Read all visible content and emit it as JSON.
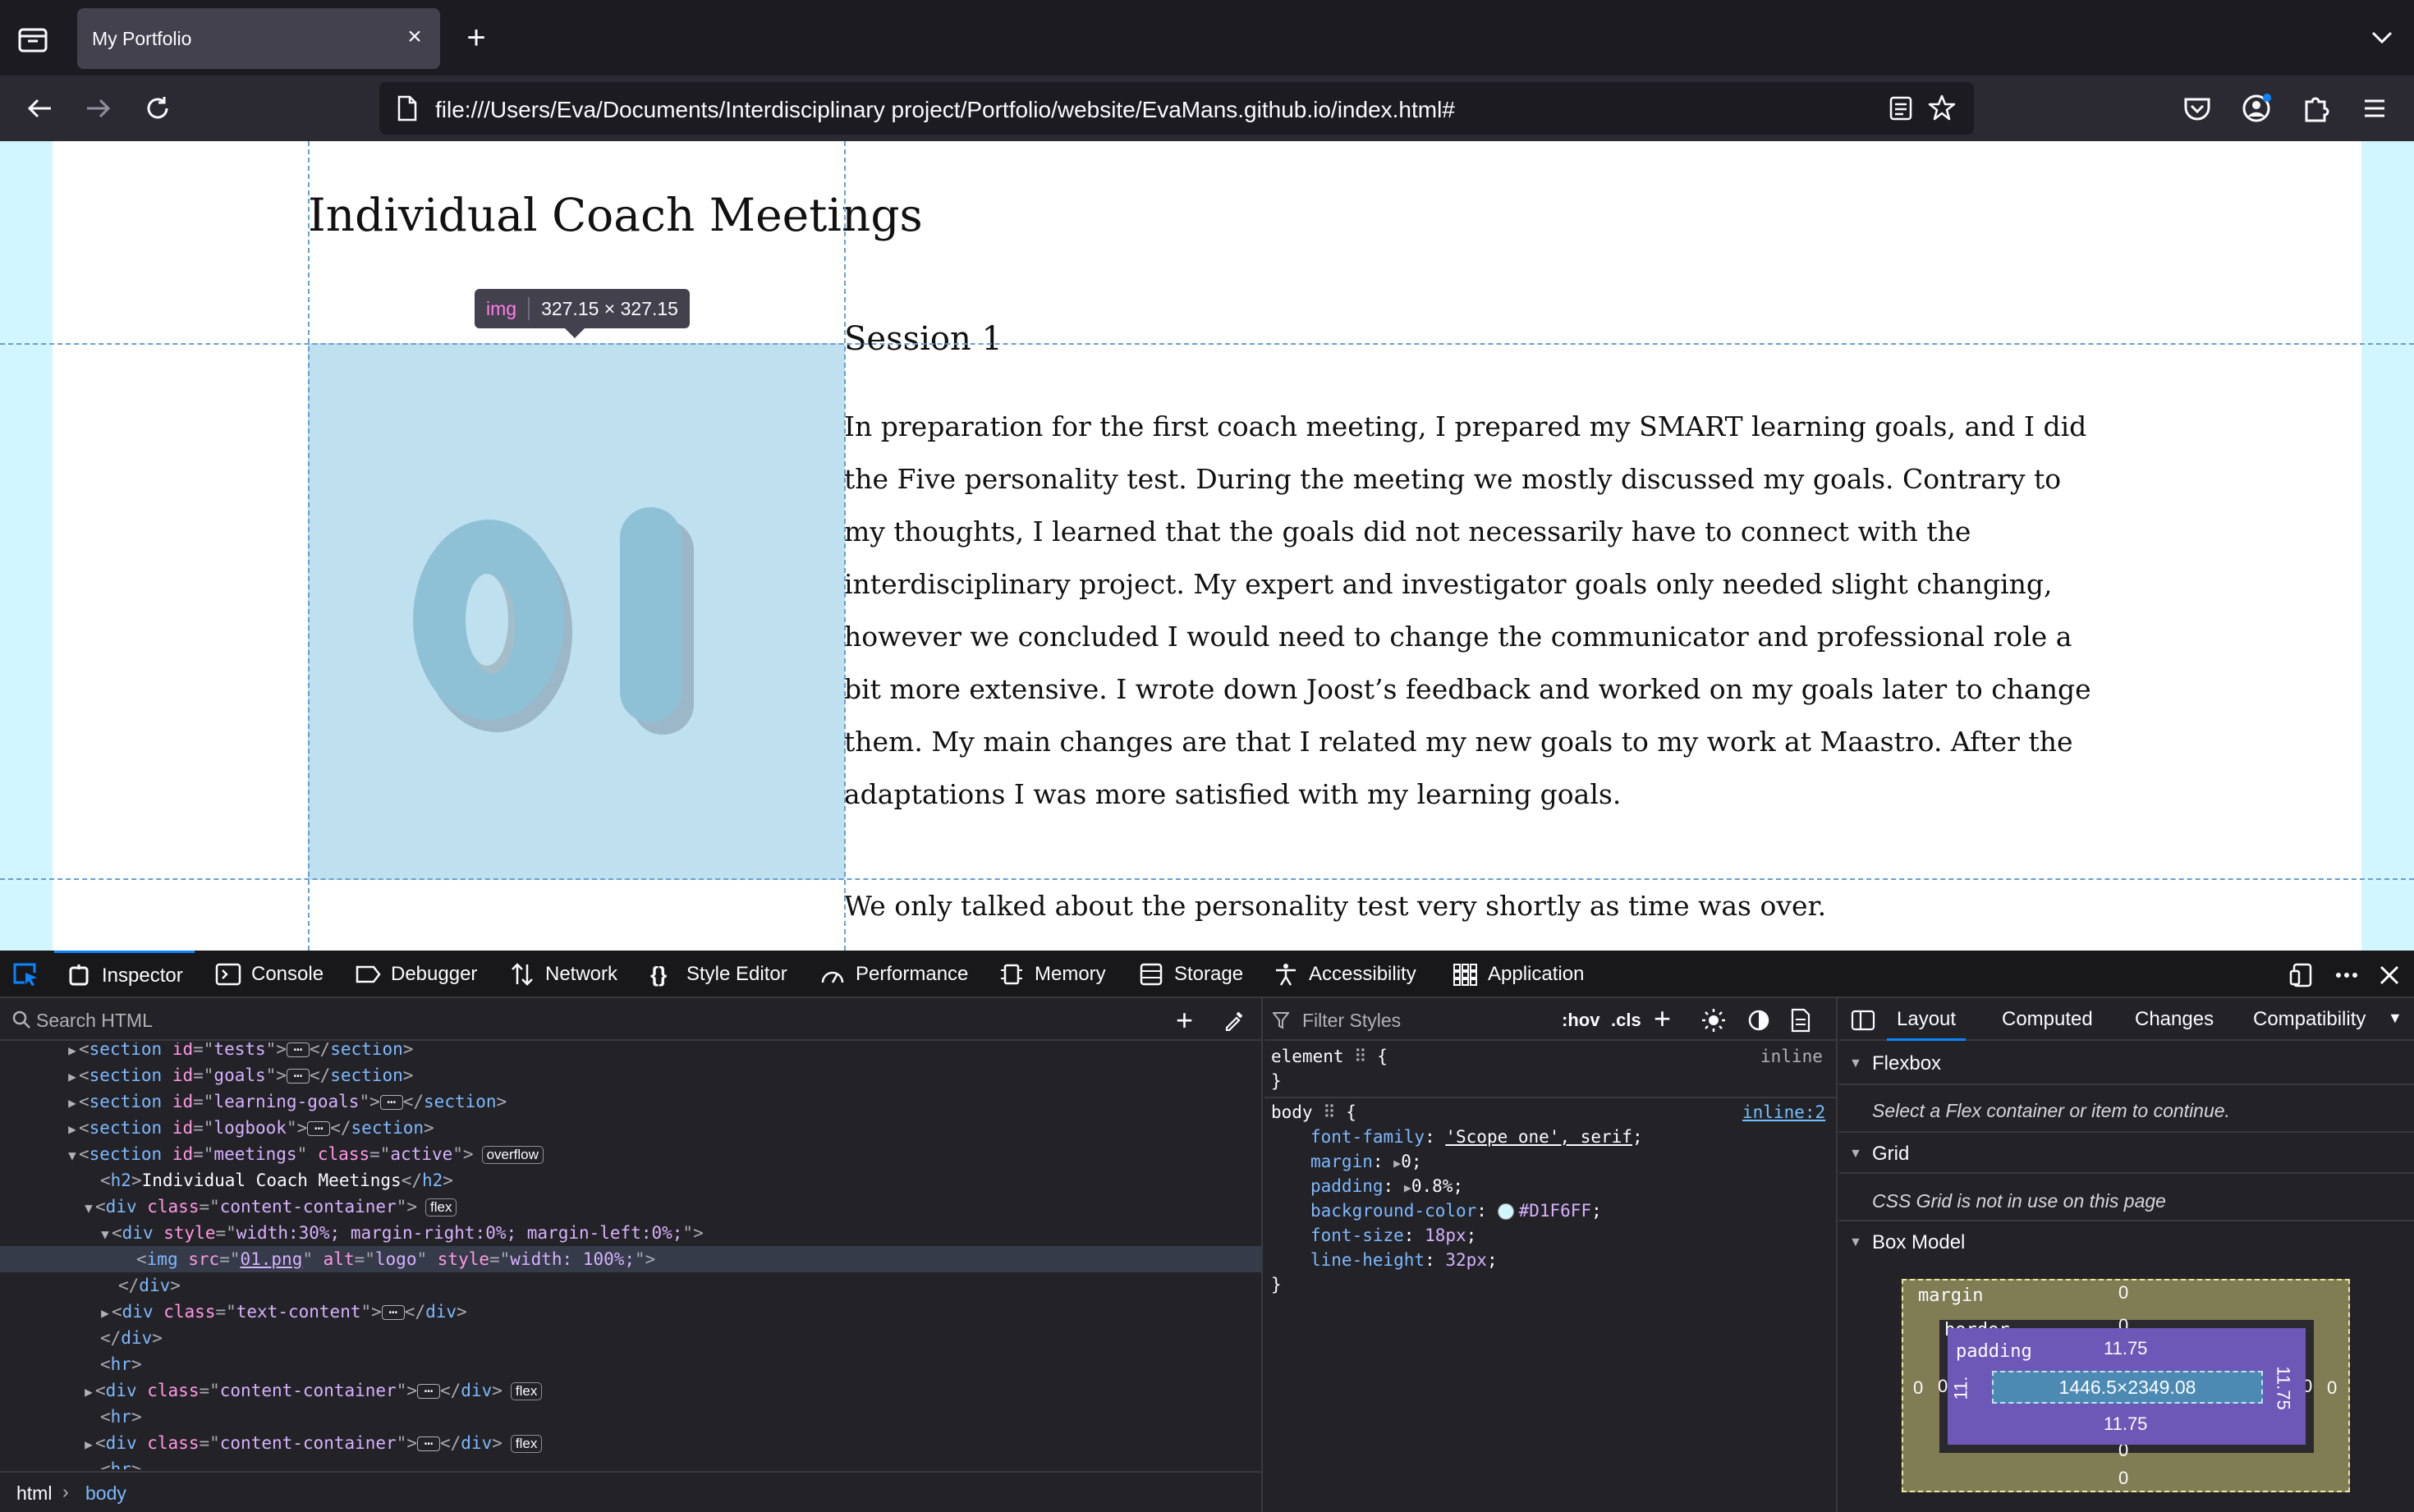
{
  "browser": {
    "tab_title": "My Portfolio",
    "tab_close": "×",
    "new_tab": "+",
    "url": "file:///Users/Eva/Documents/Interdisciplinary project/Portfolio/website/EvaMans.github.io/index.html#"
  },
  "page": {
    "heading": "Individual Coach Meetings",
    "session_title": "Session 1",
    "paragraph1": "In preparation for the first coach meeting, I prepared my SMART learning goals, and I did the Five personality test. During the meeting we mostly discussed my goals. Contrary to my thoughts, I learned that the goals did not necessarily have to connect with the interdisciplinary project. My expert and investigator goals only needed slight changing, however we concluded I would need to change the communicator and professional role a bit more extensive. I wrote down Joost’s feedback and worked on my goals later to change them. My main changes are that I related my new goals to my work at Maastro. After the adaptations I was more satisfied with my learning goals.",
    "paragraph2": "We only talked about the personality test very shortly as time was over.",
    "image_logo_text": "01",
    "infobar": {
      "tag": "img",
      "size": "327.15 × 327.15"
    }
  },
  "devtools": {
    "tabs": [
      "Inspector",
      "Console",
      "Debugger",
      "Network",
      "Style Editor",
      "Performance",
      "Memory",
      "Storage",
      "Accessibility",
      "Application"
    ],
    "active_tab": "Inspector",
    "search_placeholder": "Search HTML",
    "markup": {
      "l1_id": "tests",
      "l2_id": "goals",
      "l3_id": "learning-goals",
      "l4_id": "logbook",
      "l5_id": "meetings",
      "l5_class": "active",
      "l5_badge": "overflow",
      "h2_text": "Individual Coach Meetings",
      "content_container": "content-container",
      "flex_badge": "flex",
      "div_style": "width:30%; margin-right:0%; margin-left:0%;",
      "img_src": "01.png",
      "img_alt": "logo",
      "img_style": "width: 100%;",
      "text_content": "text-content"
    },
    "breadcrumbs": [
      "html",
      "body"
    ],
    "rules": {
      "filter_placeholder": "Filter Styles",
      "hov": ":hov",
      "cls": ".cls",
      "element_selector": "element",
      "element_source": "inline",
      "body_selector": "body",
      "body_source": "inline:2",
      "font_family_prop": "font-family",
      "font_family_val": "'Scope one', serif",
      "margin_prop": "margin",
      "margin_val": "0",
      "padding_prop": "padding",
      "padding_val": "0.8%",
      "bg_prop": "background-color",
      "bg_val": "#D1F6FF",
      "font_size_prop": "font-size",
      "font_size_val": "18px",
      "line_height_prop": "line-height",
      "line_height_val": "32px"
    },
    "layout_tabs": [
      "Layout",
      "Computed",
      "Changes",
      "Compatibility"
    ],
    "sections": {
      "flexbox": "Flexbox",
      "flexbox_msg": "Select a Flex container or item to continue.",
      "grid": "Grid",
      "grid_msg": "CSS Grid is not in use on this page",
      "boxmodel": "Box Model"
    },
    "boxmodel": {
      "margin_label": "margin",
      "border_label": "border",
      "padding_label": "padding",
      "margin_top": "0",
      "margin_bottom": "0",
      "margin_left": "0",
      "margin_right": "0",
      "border_top": "0",
      "border_bottom": "0",
      "border_left": "0",
      "border_right": "0",
      "padding_top": "11.75",
      "padding_bottom": "11.75",
      "padding_left": "11.",
      "padding_right": "11.75",
      "content_size": "1446.5×2349.08"
    }
  }
}
